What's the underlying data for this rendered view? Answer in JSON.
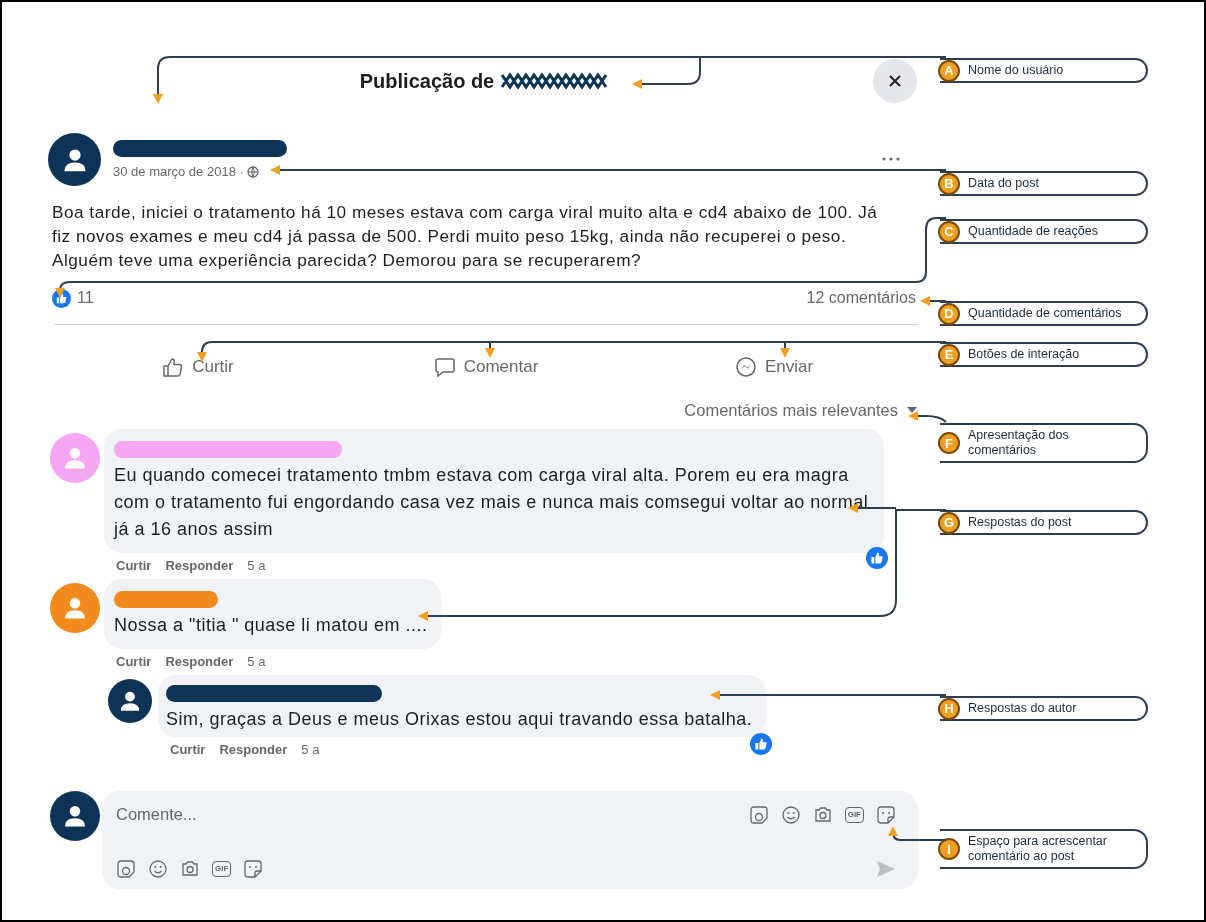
{
  "header": {
    "title": "Publicação de"
  },
  "post": {
    "date": "30 de março de 2018 ·",
    "text": "Boa tarde,  iniciei o tratamento há 10 meses estava com carga viral muito alta e cd4 abaixo de 100. Já fiz novos exames e meu cd4 já passa de 500. Perdi muito peso 15kg, ainda não recuperei o peso. Alguém teve uma experiência parecida? Demorou para se recuperarem?",
    "reaction_count": "11",
    "comment_count": "12 comentários"
  },
  "actions": [
    {
      "label": "Curtir",
      "kind": "like"
    },
    {
      "label": "Comentar",
      "kind": "comment"
    },
    {
      "label": "Enviar",
      "kind": "send"
    }
  ],
  "sort": {
    "label": "Comentários mais relevantes"
  },
  "comments": [
    {
      "color": "#f5a6f2",
      "text": "Eu quando comecei tratamento tmbm estava com carga viral alta. Porem eu era magra com o tratamento fui engordando casa vez mais e nunca mais comsegui voltar ao normal já a 16 anos assim",
      "liked": true,
      "actions": [
        "Curtir",
        "Responder",
        "5 a"
      ]
    },
    {
      "color": "#f28a1e",
      "text": "Nossa a \"titia \" quase li matou em ....",
      "liked": false,
      "actions": [
        "Curtir",
        "Responder",
        "5 a"
      ],
      "children": [
        {
          "color": "#0d3457",
          "text": "Sim, graças a Deus e meus Orixas estou aqui travando essa batalha.",
          "liked": true,
          "actions": [
            "Curtir",
            "Responder",
            "5 a"
          ]
        }
      ]
    }
  ],
  "composer": {
    "placeholder": "Comente...",
    "top_icons": [
      {
        "kind": "sticker"
      },
      {
        "kind": "emoji"
      },
      {
        "kind": "camera"
      },
      {
        "kind": "gif",
        "label": "GIF"
      },
      {
        "kind": "sticker-face"
      }
    ],
    "bottom_icons": [
      {
        "kind": "sticker"
      },
      {
        "kind": "emoji"
      },
      {
        "kind": "camera"
      },
      {
        "kind": "gif",
        "label": "GIF"
      },
      {
        "kind": "sticker-face"
      }
    ]
  },
  "callouts": [
    {
      "letter": "A",
      "text": "Nome do usuário"
    },
    {
      "letter": "B",
      "text": "Data do post"
    },
    {
      "letter": "C",
      "text": "Quantidade de reações"
    },
    {
      "letter": "D",
      "text": "Quantidade de comentários"
    },
    {
      "letter": "E",
      "text": "Botões de interação"
    },
    {
      "letter": "F",
      "text": "Apresentação dos comentários"
    },
    {
      "letter": "G",
      "text": "Respostas do post"
    },
    {
      "letter": "H",
      "text": "Respostas do autor"
    },
    {
      "letter": "I",
      "text": "Espaço para acrescentar comentário ao post"
    }
  ]
}
